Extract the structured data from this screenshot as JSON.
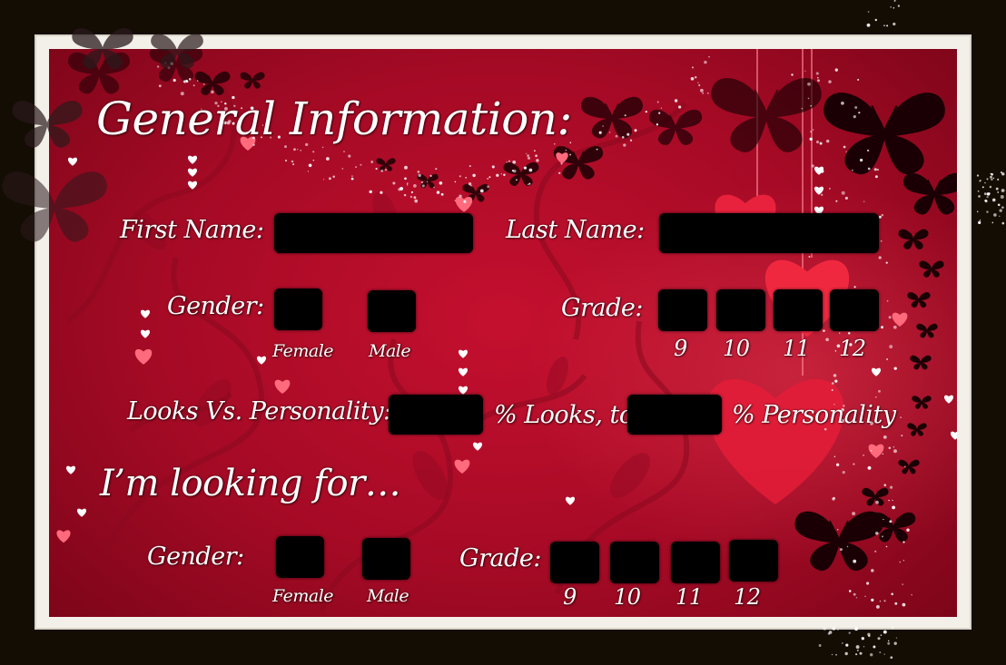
{
  "title": "General Information:",
  "fields": {
    "first_name_label": "First Name:",
    "last_name_label": "Last Name:",
    "gender_label": "Gender:",
    "female_label": "Female",
    "male_label": "Male",
    "grade_label": "Grade:",
    "grades": [
      "9",
      "10",
      "11",
      "12"
    ],
    "looks_personality_label": "Looks Vs. Personality:",
    "looks_suffix": "% Looks, to",
    "personality_suffix": "% Personality"
  },
  "looking_for": {
    "heading": "I’m looking for…",
    "gender_label": "Gender:",
    "female_label": "Female",
    "male_label": "Male",
    "grade_label": "Grade:",
    "grades": [
      "9",
      "10",
      "11",
      "12"
    ]
  },
  "colors": {
    "background_red": "#c4102f",
    "frame": "#f3f0ea",
    "outer": "#140d04",
    "field_fill": "#000000",
    "text": "#ffffff",
    "heart": "#ff5a6e"
  },
  "icons": [
    "butterfly-icon",
    "heart-icon",
    "sparkle-icon",
    "swirl-decoration"
  ]
}
